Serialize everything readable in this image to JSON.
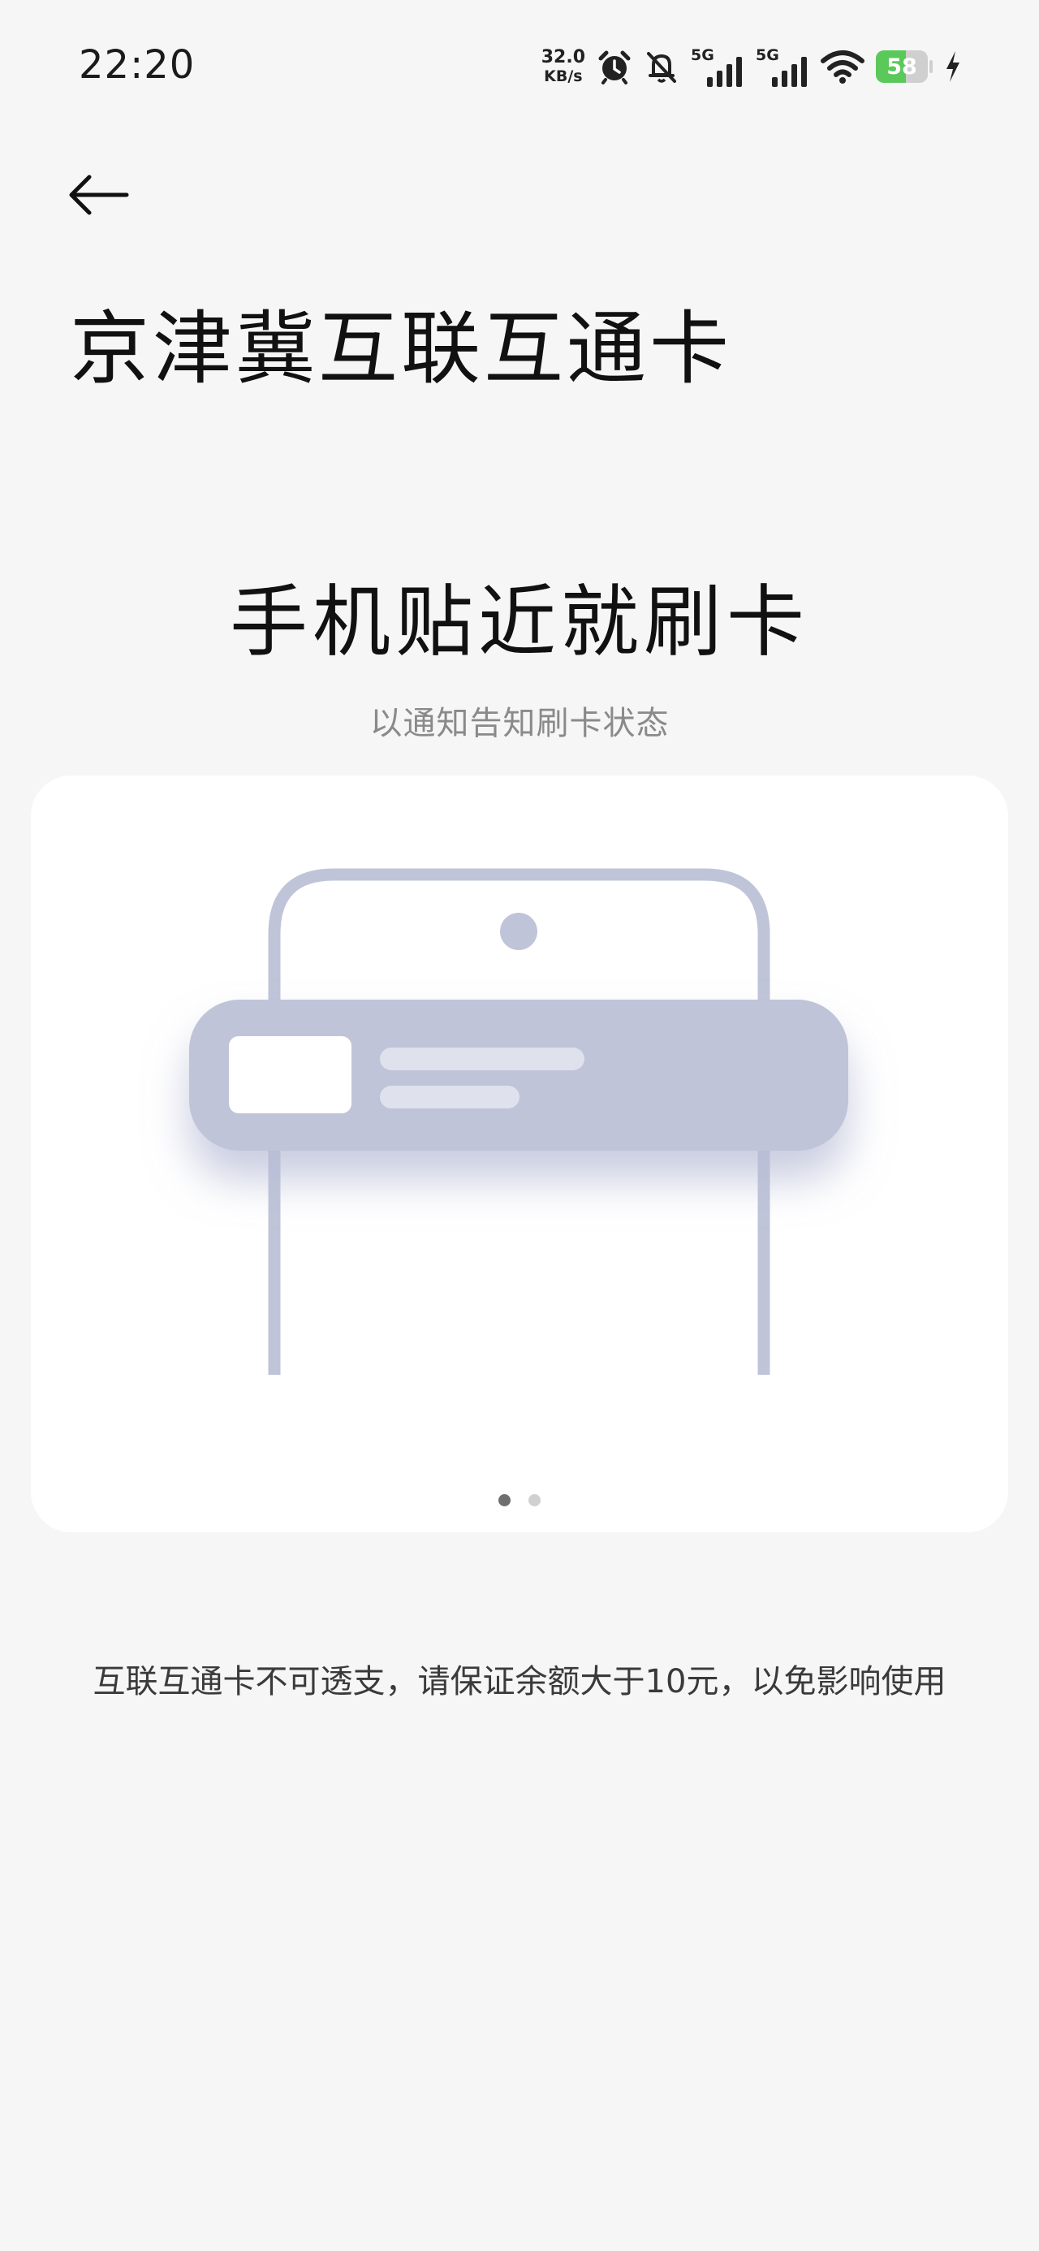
{
  "status_bar": {
    "time": "22:20",
    "net_speed_value": "32.0",
    "net_speed_unit": "KB/s",
    "sim1_tag": "5G",
    "sim2_tag": "5G",
    "battery_level": "58",
    "icons": [
      "alarm-icon",
      "mute-bell-icon",
      "signal-icon",
      "signal-icon",
      "wifi-icon",
      "battery-icon",
      "charging-icon"
    ]
  },
  "header": {
    "back_icon": "arrow-left-icon",
    "title": "京津冀互联互通卡"
  },
  "feature": {
    "title": "手机贴近就刷卡",
    "subtitle": "以通知告知刷卡状态"
  },
  "carousel": {
    "illustration": "phone-with-notification-banner",
    "page_count": 2,
    "active_page": 1
  },
  "notice": {
    "text": "互联互通卡不可透支，请保证余额大于10元，以免影响使用"
  },
  "colors": {
    "background": "#f6f6f6",
    "card": "#ffffff",
    "illustration": "#bfc4d8",
    "battery": "#5ac95a"
  }
}
